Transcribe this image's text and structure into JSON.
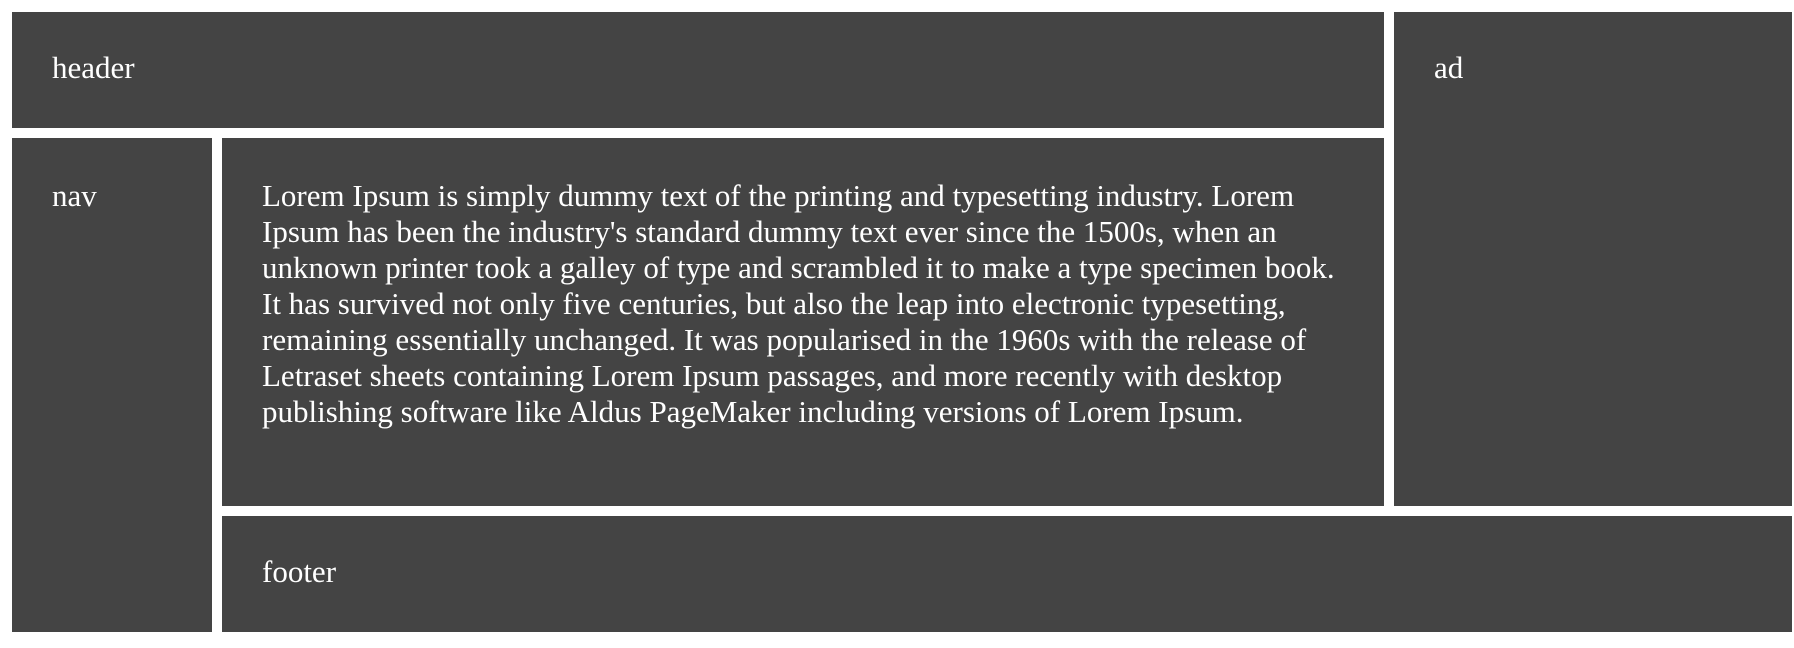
{
  "layout": {
    "header": "header",
    "ad": "ad",
    "nav": "nav",
    "main": "Lorem Ipsum is simply dummy text of the printing and typesetting industry. Lorem Ipsum has been the industry's standard dummy text ever since the 1500s, when an unknown printer took a galley of type and scrambled it to make a type specimen book. It has survived not only five centuries, but also the leap into electronic typesetting, remaining essentially unchanged. It was popularised in the 1960s with the release of Letraset sheets containing Lorem Ipsum passages, and more recently with desktop publishing software like Aldus PageMaker including versions of Lorem Ipsum.",
    "footer": "footer"
  },
  "colors": {
    "panel_background": "#444444",
    "panel_text": "#ffffff",
    "page_background": "#ffffff"
  }
}
